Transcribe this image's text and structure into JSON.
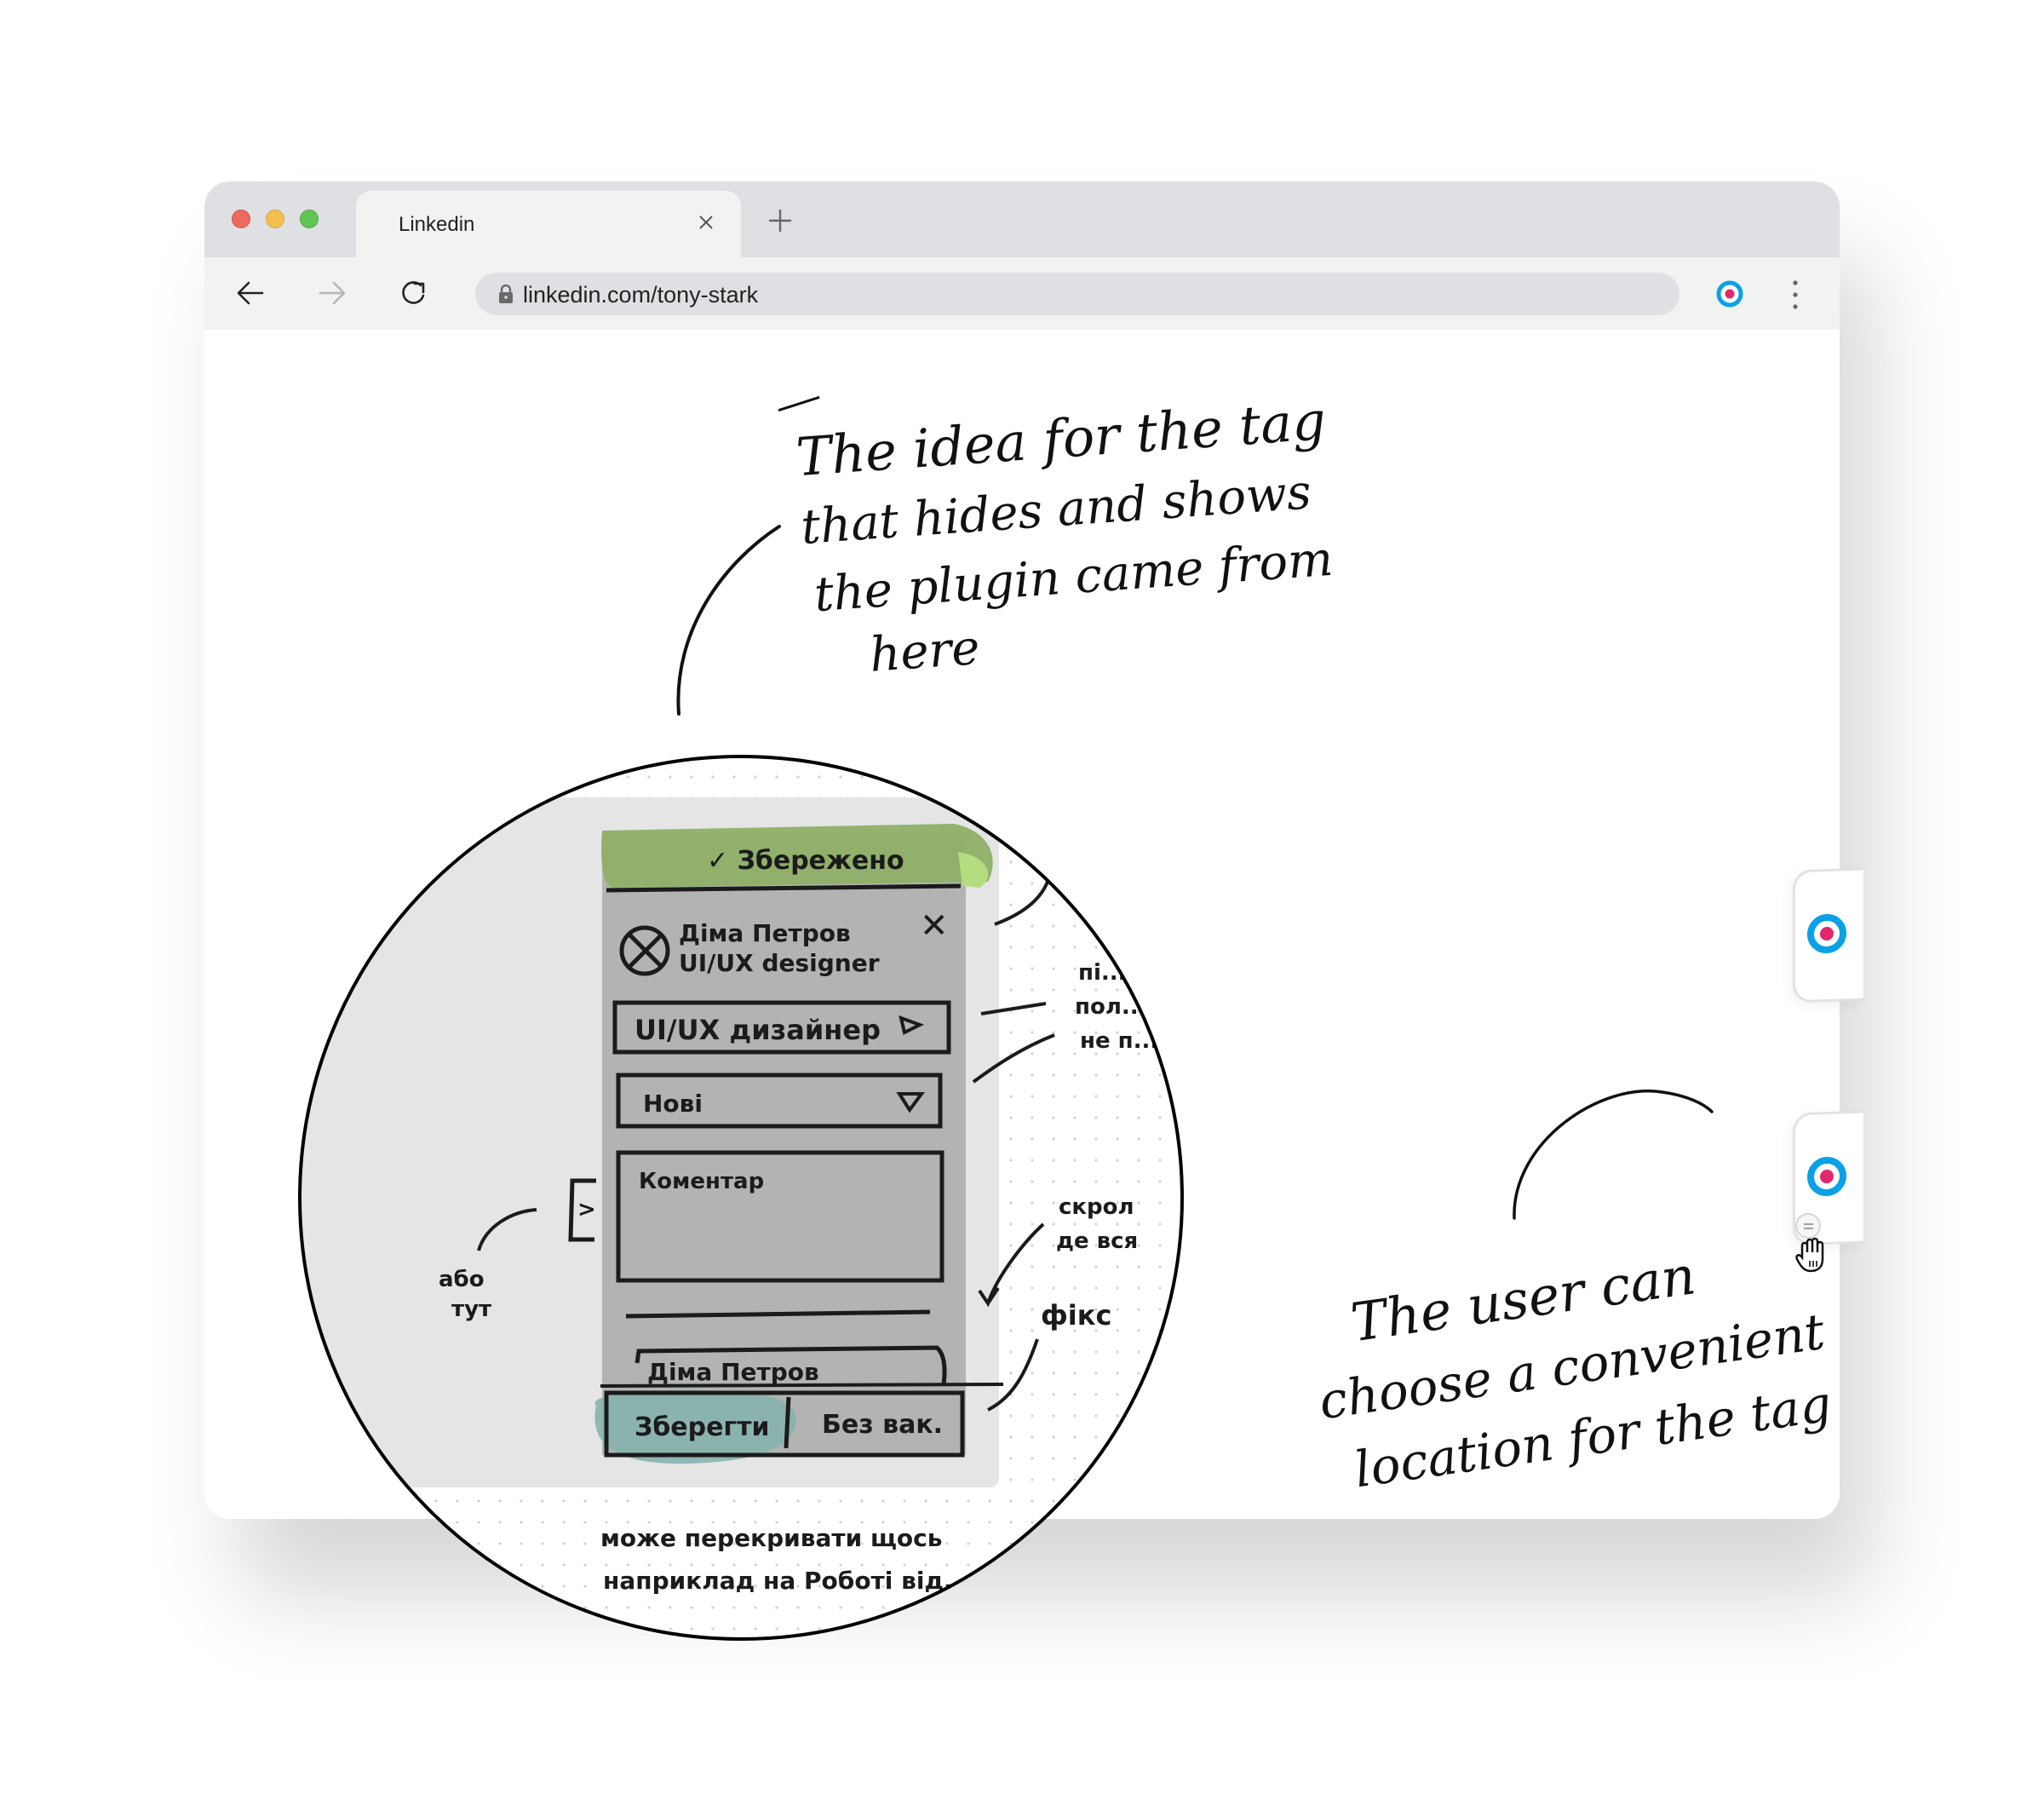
{
  "browser": {
    "tab": {
      "title": "Linkedin",
      "close_icon": "close-icon"
    },
    "new_tab_icon": "plus-icon",
    "toolbar": {
      "back_icon": "arrow-left-icon",
      "forward_icon": "arrow-right-icon",
      "reload_icon": "reload-icon",
      "lock_icon": "lock-icon",
      "url": "linkedin.com/tony-stark",
      "extension_icon": "target-icon",
      "menu_icon": "kebab-menu-icon"
    }
  },
  "colors": {
    "target_ring": "#0aa1e6",
    "target_dot": "#e0286a",
    "saved_banner": "#8fb067",
    "save_button_highlight": "#86b3ad"
  },
  "notes": {
    "top": {
      "lines": [
        "The idea for the tag",
        "that hides and shows",
        "the plugin came from",
        "here"
      ]
    },
    "bottom_right": {
      "lines": [
        "The user can",
        "choose a convenient",
        "location for the tag"
      ]
    }
  },
  "sketch": {
    "saved_banner": "✓ Збережено",
    "profile": {
      "name": "Діма Петров",
      "title": "UI/UX designer"
    },
    "close_mark": "✕",
    "select_vacancy": "UI/UX дизайнер",
    "select_status": "Нові",
    "comment_placeholder": "Коментар",
    "name_field": "Діма Петров",
    "save_button": "Зберегти",
    "no_vacancy_button": "Без вак.",
    "expand_tab": ">",
    "left_note": [
      "або",
      "тут"
    ],
    "right_note_1": [
      "пі...",
      "пол...",
      "не п..."
    ],
    "right_note_2": [
      "скрол",
      "де вся"
    ],
    "right_note_3": "фікс",
    "bottom_note": [
      "може перекривати щось",
      "наприклад на Роботі від..."
    ]
  },
  "side_tags": [
    {
      "icon": "target-icon"
    },
    {
      "icon": "target-icon",
      "drag_handle_icon": "drag-handle-icon",
      "cursor_icon": "grab-hand-cursor-icon"
    }
  ]
}
